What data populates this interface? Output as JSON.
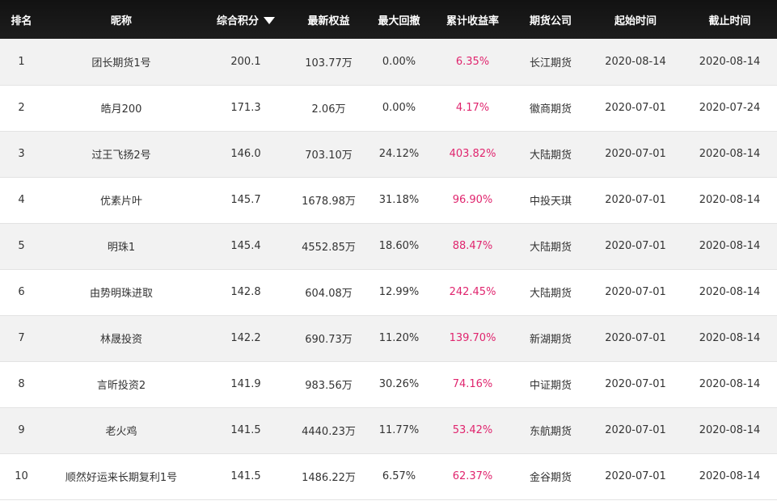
{
  "columns": {
    "rank": "排名",
    "nickname": "昵称",
    "score": "综合积分",
    "equity": "最新权益",
    "drawdown": "最大回撤",
    "return": "累计收益率",
    "company": "期货公司",
    "start": "起始时间",
    "end": "截止时间"
  },
  "sort_icon": "caret-down-icon",
  "colors": {
    "header_bg": "#161616",
    "row_odd": "#f2f2f2",
    "row_even": "#ffffff",
    "return_text": "#e0256e"
  },
  "rows": [
    {
      "rank": "1",
      "nickname": "团长期货1号",
      "score": "200.1",
      "equity": "103.77万",
      "drawdown": "0.00%",
      "return": "6.35%",
      "company": "长江期货",
      "start": "2020-08-14",
      "end": "2020-08-14"
    },
    {
      "rank": "2",
      "nickname": "皓月200",
      "score": "171.3",
      "equity": "2.06万",
      "drawdown": "0.00%",
      "return": "4.17%",
      "company": "徽商期货",
      "start": "2020-07-01",
      "end": "2020-07-24"
    },
    {
      "rank": "3",
      "nickname": "过王飞扬2号",
      "score": "146.0",
      "equity": "703.10万",
      "drawdown": "24.12%",
      "return": "403.82%",
      "company": "大陆期货",
      "start": "2020-07-01",
      "end": "2020-08-14"
    },
    {
      "rank": "4",
      "nickname": "优素片叶",
      "score": "145.7",
      "equity": "1678.98万",
      "drawdown": "31.18%",
      "return": "96.90%",
      "company": "中投天琪",
      "start": "2020-07-01",
      "end": "2020-08-14"
    },
    {
      "rank": "5",
      "nickname": "明珠1",
      "score": "145.4",
      "equity": "4552.85万",
      "drawdown": "18.60%",
      "return": "88.47%",
      "company": "大陆期货",
      "start": "2020-07-01",
      "end": "2020-08-14"
    },
    {
      "rank": "6",
      "nickname": "由势明珠进取",
      "score": "142.8",
      "equity": "604.08万",
      "drawdown": "12.99%",
      "return": "242.45%",
      "company": "大陆期货",
      "start": "2020-07-01",
      "end": "2020-08-14"
    },
    {
      "rank": "7",
      "nickname": "林晟投资",
      "score": "142.2",
      "equity": "690.73万",
      "drawdown": "11.20%",
      "return": "139.70%",
      "company": "新湖期货",
      "start": "2020-07-01",
      "end": "2020-08-14"
    },
    {
      "rank": "8",
      "nickname": "言昕投资2",
      "score": "141.9",
      "equity": "983.56万",
      "drawdown": "30.26%",
      "return": "74.16%",
      "company": "中证期货",
      "start": "2020-07-01",
      "end": "2020-08-14"
    },
    {
      "rank": "9",
      "nickname": "老火鸡",
      "score": "141.5",
      "equity": "4440.23万",
      "drawdown": "11.77%",
      "return": "53.42%",
      "company": "东航期货",
      "start": "2020-07-01",
      "end": "2020-08-14"
    },
    {
      "rank": "10",
      "nickname": "顺然好运来长期复利1号",
      "score": "141.5",
      "equity": "1486.22万",
      "drawdown": "6.57%",
      "return": "62.37%",
      "company": "金谷期货",
      "start": "2020-07-01",
      "end": "2020-08-14"
    }
  ]
}
